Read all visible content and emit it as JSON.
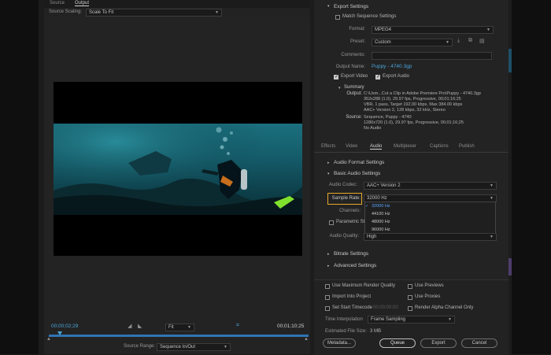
{
  "left": {
    "tabs": [
      "Source",
      "Output"
    ],
    "scaling_label": "Source Scaling:",
    "scaling_value": "Scale To Fit",
    "timecode_in": "00;00;02;29",
    "timecode_out": "00;01;10;25",
    "fit_value": "Fit",
    "source_range_label": "Source Range:",
    "source_range_value": "Sequence In/Out"
  },
  "right": {
    "export_settings": "Export Settings",
    "match_sequence": "Match Sequence Settings",
    "format_label": "Format:",
    "format_value": "MPEG4",
    "preset_label": "Preset:",
    "preset_value": "Custom",
    "comments_label": "Comments:",
    "output_name_label": "Output Name:",
    "output_name_value": "Puppy - 4740.3gp",
    "export_video": "Export Video",
    "export_audio": "Export Audio",
    "summary": "Summary",
    "output_label": "Output:",
    "output_lines": [
      "C:\\Usm...Cut a Clip in Adobe Premiere Pro\\Puppy - 4740.3gp",
      "352x288 (1.0), 29.97 fps, Progressive, 00;01;16;25",
      "VBR, 1 pass, Target 192.00 kbps, Max 384.00 kbps",
      "AAC+ Version 2, 128 kbps, 32 kHz, Stereo"
    ],
    "source_label": "Source:",
    "source_lines": [
      "Sequence, Puppy - 4740",
      "1280x720 (1.0), 29.97 fps, Progressive, 00;01;16;25",
      "No Audio"
    ],
    "tabs": [
      "Effects",
      "Video",
      "Audio",
      "Multiplexer",
      "Captions",
      "Publish"
    ],
    "audio_format_settings": "Audio Format Settings",
    "basic_audio_settings": "Basic Audio Settings",
    "audio_codec_label": "Audio Codec:",
    "audio_codec_value": "AAC+ Version 2",
    "sample_rate_label": "Sample Rate:",
    "sample_rate_value": "32000 Hz",
    "sample_rate_options": [
      "32000 Hz",
      "44100 Hz",
      "48000 Hz",
      "96000 Hz"
    ],
    "channels_label": "Channels:",
    "parametric_label": "Parametric St",
    "audio_quality_label": "Audio Quality:",
    "audio_quality_value": "High",
    "bitrate_settings": "Bitrate Settings",
    "advanced_settings": "Advanced Settings",
    "use_max_render": "Use Maximum Render Quality",
    "use_previews": "Use Previews",
    "import_into_project": "Import Into Project",
    "use_proxies": "Use Proxies",
    "set_start_timecode": "Set Start Timecode",
    "start_timecode_value": "00;00;00;00",
    "render_alpha": "Render Alpha Channel Only",
    "time_interp_label": "Time Interpolation",
    "time_interp_value": "Frame Sampling",
    "est_size_label": "Estimated File Size:",
    "est_size_value": "3 MB",
    "btn_metadata": "Metadata...",
    "btn_queue": "Queue",
    "btn_export": "Export",
    "btn_cancel": "Cancel"
  },
  "colors": {
    "accent_blue": "#4aa3d8",
    "highlight": "#e6a92a"
  }
}
